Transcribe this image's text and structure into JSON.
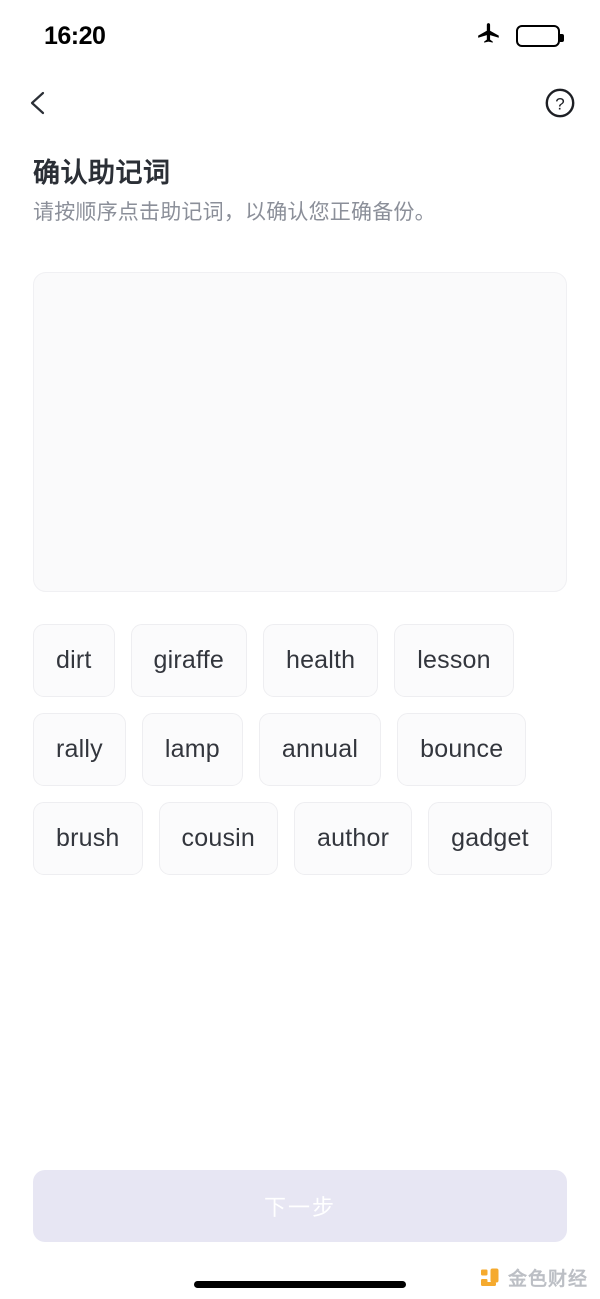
{
  "status_bar": {
    "time": "16:20",
    "airplane_icon": "airplane-mode-icon",
    "battery_icon": "battery-low-power-icon",
    "battery_level_percent": 40,
    "battery_fill_color": "#f7c62a"
  },
  "nav": {
    "back_icon": "chevron-left-icon",
    "help_icon": "question-circle-icon"
  },
  "heading": {
    "title": "确认助记词",
    "subtitle": "请按顺序点击助记词，以确认您正确备份。"
  },
  "answer_area": {
    "selected_words": [],
    "background_color": "#fafafb",
    "border_color": "#f0f0f3"
  },
  "word_pool": {
    "words": [
      "dirt",
      "giraffe",
      "health",
      "lesson",
      "rally",
      "lamp",
      "annual",
      "bounce",
      "brush",
      "cousin",
      "author",
      "gadget"
    ],
    "chip_background": "#fbfbfc",
    "chip_text_color": "#33363d"
  },
  "footer": {
    "next_label": "下一步",
    "next_enabled": false,
    "next_background": "#e7e6f3",
    "next_text_color": "#ffffff"
  },
  "watermark": {
    "text": "金色财经",
    "logo_color": "#f5a623"
  }
}
